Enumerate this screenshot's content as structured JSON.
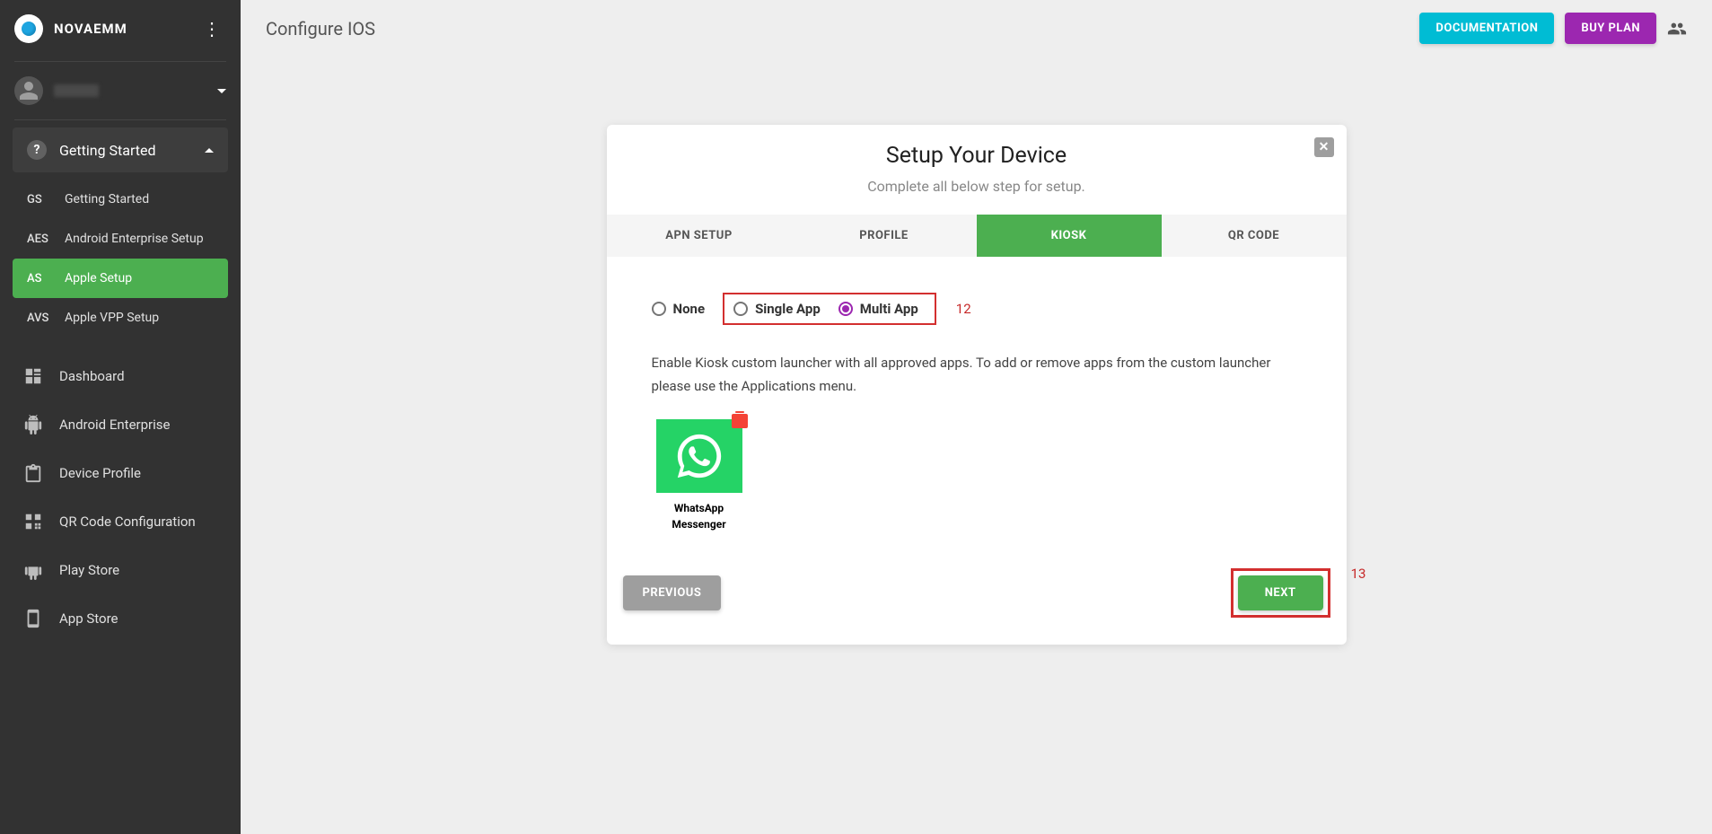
{
  "brand": "NOVAEMM",
  "page_title": "Configure IOS",
  "topbar": {
    "documentation": "DOCUMENTATION",
    "buy_plan": "BUY PLAN"
  },
  "sidebar": {
    "getting_started_label": "Getting Started",
    "sub_items": [
      {
        "abbr": "GS",
        "label": "Getting Started"
      },
      {
        "abbr": "AES",
        "label": "Android Enterprise Setup"
      },
      {
        "abbr": "AS",
        "label": "Apple Setup"
      },
      {
        "abbr": "AVS",
        "label": "Apple VPP Setup"
      }
    ],
    "main_items": [
      {
        "key": "dashboard",
        "label": "Dashboard"
      },
      {
        "key": "android_enterprise",
        "label": "Android Enterprise"
      },
      {
        "key": "device_profile",
        "label": "Device Profile"
      },
      {
        "key": "qr_code_config",
        "label": "QR Code Configuration"
      },
      {
        "key": "play_store",
        "label": "Play Store"
      },
      {
        "key": "app_store",
        "label": "App Store"
      }
    ]
  },
  "card": {
    "title": "Setup Your Device",
    "subtitle": "Complete all below step for setup.",
    "tabs": [
      {
        "label": "APN SETUP",
        "active": false
      },
      {
        "label": "PROFILE",
        "active": false
      },
      {
        "label": "KIOSK",
        "active": true
      },
      {
        "label": "QR CODE",
        "active": false
      }
    ],
    "kiosk": {
      "options": {
        "none": "None",
        "single": "Single App",
        "multi": "Multi App",
        "selected": "multi"
      },
      "description": "Enable Kiosk custom launcher with all approved apps. To add or remove apps from the custom launcher please use the Applications menu.",
      "app": {
        "name": "WhatsApp Messenger"
      }
    },
    "buttons": {
      "previous": "PREVIOUS",
      "next": "NEXT"
    }
  },
  "annotations": {
    "radio_group": "12",
    "next_button": "13"
  }
}
